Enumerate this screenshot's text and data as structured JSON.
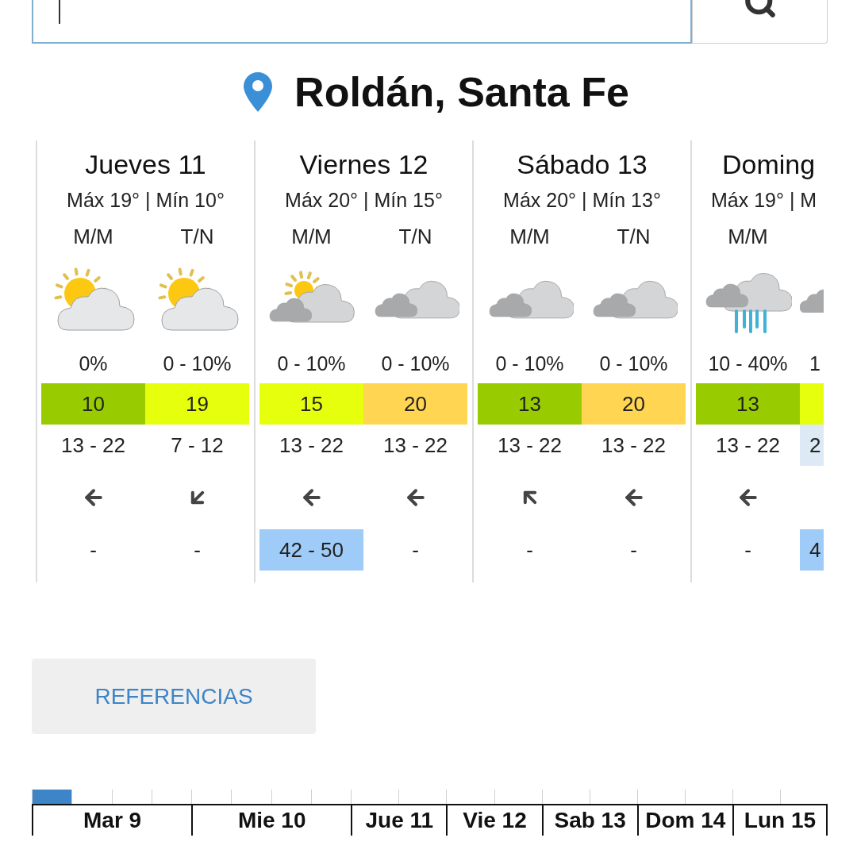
{
  "location": {
    "title": "Roldán, Santa Fe"
  },
  "days": [
    {
      "title": "Jueves 11",
      "maxmin": "Máx 19° | Mín 10°",
      "periods": [
        {
          "label": "M/M",
          "precip": "0%",
          "index": {
            "text": "10",
            "color": "#99cc00"
          },
          "wind": {
            "text": "13 - 22"
          },
          "gust": {
            "text": "-"
          }
        },
        {
          "label": "T/N",
          "precip": "0 - 10%",
          "index": {
            "text": "19",
            "color": "#e5ff0d"
          },
          "wind": {
            "text": "7 - 12"
          },
          "gust": {
            "text": "-"
          }
        }
      ]
    },
    {
      "title": "Viernes 12",
      "maxmin": "Máx 20° | Mín 15°",
      "periods": [
        {
          "label": "M/M",
          "precip": "0 - 10%",
          "index": {
            "text": "15",
            "color": "#e5ff0d"
          },
          "wind": {
            "text": "13 - 22"
          },
          "gust": {
            "text": "42 - 50",
            "color": "#9ecbf7"
          }
        },
        {
          "label": "T/N",
          "precip": "0 - 10%",
          "index": {
            "text": "20",
            "color": "#ffd552"
          },
          "wind": {
            "text": "13 - 22"
          },
          "gust": {
            "text": "-"
          }
        }
      ]
    },
    {
      "title": "Sábado 13",
      "maxmin": "Máx 20° | Mín 13°",
      "periods": [
        {
          "label": "M/M",
          "precip": "0 - 10%",
          "index": {
            "text": "13",
            "color": "#99cc00"
          },
          "wind": {
            "text": "13 - 22"
          },
          "gust": {
            "text": "-"
          }
        },
        {
          "label": "T/N",
          "precip": "0 - 10%",
          "index": {
            "text": "20",
            "color": "#ffd552"
          },
          "wind": {
            "text": "13 - 22"
          },
          "gust": {
            "text": "-"
          }
        }
      ]
    },
    {
      "title": "Doming",
      "maxmin": "Máx 19° | M",
      "periods": [
        {
          "label": "M/M",
          "precip": "10 - 40%",
          "index": {
            "text": "13",
            "color": "#99cc00"
          },
          "wind": {
            "text": "13 - 22"
          },
          "gust": {
            "text": "-"
          }
        },
        {
          "precip": "1",
          "index": {
            "color": "#e5ff0d"
          },
          "wind": {
            "text": "2",
            "color": "#dde9f4"
          },
          "gust": {
            "text": "4",
            "color": "#9ecbf7"
          }
        }
      ]
    }
  ],
  "references_button": "REFERENCIAS",
  "timeline": [
    {
      "label": "Mar 9",
      "kind": "quarters"
    },
    {
      "label": "Mie 10",
      "kind": "quarters"
    },
    {
      "label": "Jue 11",
      "kind": "halves"
    },
    {
      "label": "Vie 12",
      "kind": "halves"
    },
    {
      "label": "Sab 13",
      "kind": "halves"
    },
    {
      "label": "Dom 14",
      "kind": "halves"
    },
    {
      "label": "Lun 15",
      "kind": "halves"
    }
  ]
}
